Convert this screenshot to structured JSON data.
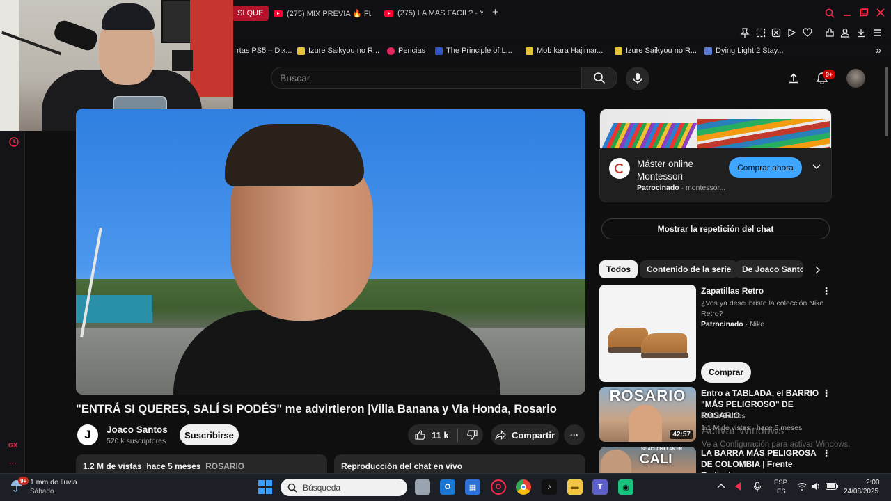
{
  "browser": {
    "tabs": [
      {
        "label": "SI QUE",
        "active": true
      },
      {
        "label": "(275) MIX PREVIA 🔥 FLO",
        "active": false
      },
      {
        "label": "(275) LA MAS FACIL? - Yo",
        "active": false
      }
    ],
    "new_tab": "+",
    "bookmarks": [
      {
        "label": "rtas PS5 – Dix..."
      },
      {
        "label": "Izure Saikyou no R..."
      },
      {
        "label": "Pericias"
      },
      {
        "label": "The Principle of L..."
      },
      {
        "label": "Mob kara Hajimar..."
      },
      {
        "label": "Izure Saikyou no R..."
      },
      {
        "label": "Dying Light 2 Stay..."
      }
    ],
    "more_bookmarks": "»",
    "sidebar_badge": "GX"
  },
  "youtube": {
    "search_placeholder": "Buscar",
    "notifications_badge": "9+",
    "video": {
      "title": "\"ENTRÁ SI QUERES, SALÍ SI PODÉS\" me advirtieron |Villa Banana y Via Honda, Rosario",
      "channel_initial": "J",
      "channel_name": "Joaco Santos",
      "subscribers": "520 k suscriptores",
      "subscribe_label": "Suscribirse",
      "likes": "11 k",
      "share_label": "Compartir",
      "more_label": "···",
      "views": "1.2 M de vistas",
      "uploaded": "hace 5 meses",
      "tag": "ROSARIO",
      "chat_box_title": "Reproducción del chat en vivo"
    },
    "ad_card": {
      "title_line1": "Máster online",
      "title_line2": "Montessori",
      "sponsored": "Patrocinado",
      "advertiser": "montessor...",
      "cta": "Comprar ahora"
    },
    "chat_replay_label": "Mostrar la repetición del chat",
    "chips": [
      {
        "label": "Todos",
        "active": true
      },
      {
        "label": "Contenido de la serie",
        "active": false
      },
      {
        "label": "De Joaco Santos",
        "active": false
      }
    ],
    "recommendations": [
      {
        "title": "Zapatillas Retro",
        "desc": "¿Vos ya descubriste la colección Nike Retro?",
        "sponsored": "Patrocinado",
        "advertiser": "Nike",
        "cta": "Comprar"
      },
      {
        "thumb_text": "ROSARIO",
        "title": "Entro a TABLADA, el BARRIO \"MÁS PELIGROSO\" DE ROSARIO",
        "channel": "Joaco Santos",
        "meta": "1.1 M de vistas · hace 5 meses",
        "duration": "42:57"
      },
      {
        "thumb_text": "CALI",
        "thumb_small": "SE ACUCHILLAN EN",
        "title": "LA BARRA MÁS PELIGROSA DE COLOMBIA | Frente Radical ...",
        "channel": "",
        "meta": ""
      }
    ]
  },
  "windows_watermark": {
    "line1": "Activar Windows",
    "line2": "Ve a Configuración para activar Windows."
  },
  "taskbar": {
    "weather_badge": "9+",
    "weather_line1": "1 mm de lluvia",
    "weather_line2": "Sábado",
    "search_placeholder": "Búsqueda",
    "lang_line1": "ESP",
    "lang_line2": "ES",
    "time": "2:00",
    "date": "24/08/2025"
  },
  "colors": {
    "accent_red": "#ff2a4a",
    "youtube_red": "#ff0033",
    "cta_blue": "#3ea6ff"
  }
}
